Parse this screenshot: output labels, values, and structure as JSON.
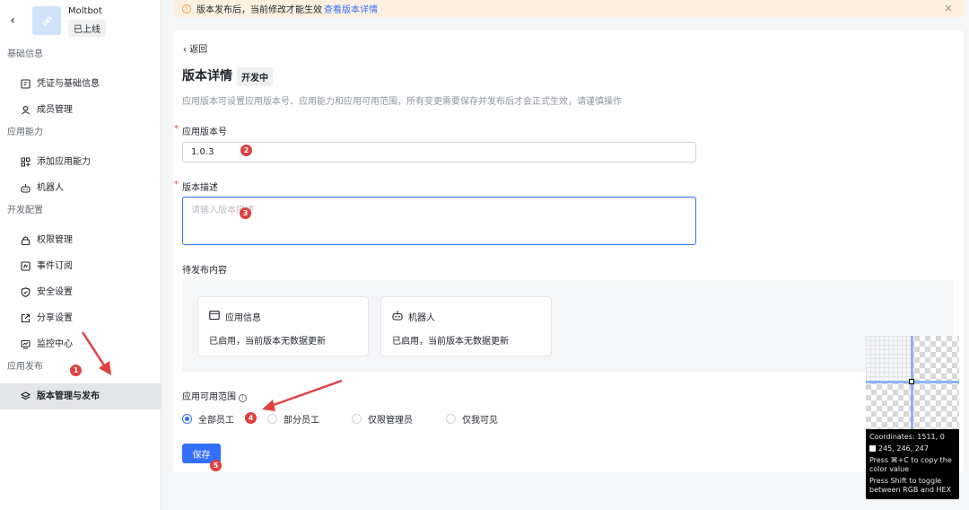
{
  "app": {
    "name": "Moltbot",
    "status": "已上线"
  },
  "sidebar": {
    "groups": [
      {
        "title": "基础信息",
        "items": [
          {
            "label": "凭证与基础信息",
            "icon": "credential-icon"
          },
          {
            "label": "成员管理",
            "icon": "user-icon"
          }
        ]
      },
      {
        "title": "应用能力",
        "items": [
          {
            "label": "添加应用能力",
            "icon": "grid-plus-icon"
          },
          {
            "label": "机器人",
            "icon": "robot-icon"
          }
        ]
      },
      {
        "title": "开发配置",
        "items": [
          {
            "label": "权限管理",
            "icon": "lock-icon"
          },
          {
            "label": "事件订阅",
            "icon": "event-icon"
          },
          {
            "label": "安全设置",
            "icon": "shield-icon"
          },
          {
            "label": "分享设置",
            "icon": "share-icon"
          },
          {
            "label": "监控中心",
            "icon": "monitor-icon"
          }
        ]
      },
      {
        "title": "应用发布",
        "items": [
          {
            "label": "版本管理与发布",
            "icon": "layers-icon",
            "active": true
          }
        ]
      }
    ]
  },
  "notice": {
    "text": "版本发布后，当前修改才能生效",
    "link": "查看版本详情"
  },
  "page": {
    "back": "返回",
    "title": "版本详情",
    "tag": "开发中",
    "description": "应用版本可设置应用版本号、应用能力和应用可用范围，所有变更需要保存并发布后才会正式生效，请谨慎操作"
  },
  "form": {
    "version_label": "应用版本号",
    "version_value": "1.0.3",
    "desc_label": "版本描述",
    "desc_placeholder": "请输入版本描述",
    "pending_label": "待发布内容",
    "pending_items": [
      {
        "title": "应用信息",
        "desc": "已启用，当前版本无数据更新",
        "icon": "app-info-icon"
      },
      {
        "title": "机器人",
        "desc": "已启用，当前版本无数据更新",
        "icon": "robot-icon"
      }
    ],
    "scope_label": "应用可用范围",
    "scope_options": [
      {
        "label": "全部员工",
        "selected": true
      },
      {
        "label": "部分员工",
        "selected": false
      },
      {
        "label": "仅限管理员",
        "selected": false
      },
      {
        "label": "仅我可见",
        "selected": false
      }
    ],
    "save_label": "保存"
  },
  "markers": [
    "1",
    "2",
    "3",
    "4",
    "5"
  ],
  "picker": {
    "coordinates": "Coordinates: 1511, 0",
    "color": "245, 246, 247",
    "copy_hint": "Press ⌘+C to copy the color value",
    "toggle_hint": "Press Shift to toggle between RGB and HEX"
  },
  "colors": {
    "accent": "#3370ff",
    "marker": "#e04040",
    "notice_bg": "#fdf0e1"
  }
}
